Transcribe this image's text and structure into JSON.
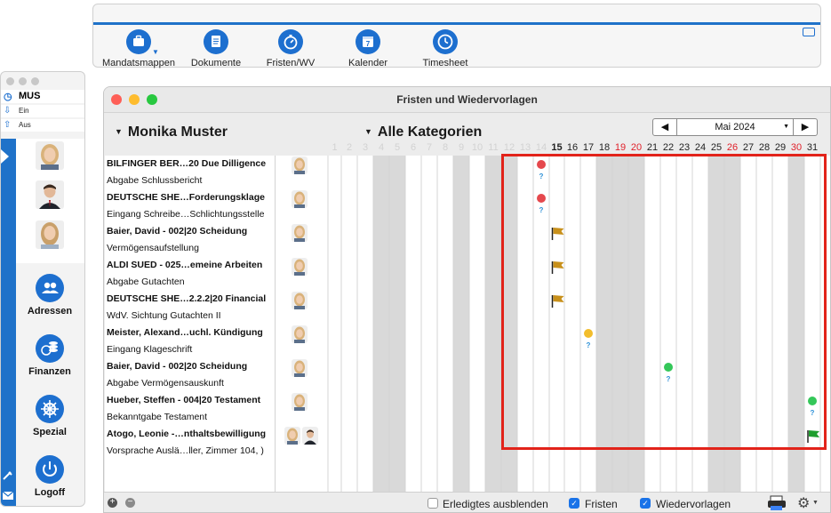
{
  "toolbar": {
    "items": [
      {
        "label": "Mandatsmappen",
        "icon": "briefcase-icon"
      },
      {
        "label": "Dokumente",
        "icon": "document-icon"
      },
      {
        "label": "Fristen/WV",
        "icon": "stopwatch-icon"
      },
      {
        "label": "Kalender",
        "icon": "calendar-icon"
      },
      {
        "label": "Timesheet",
        "icon": "clock-icon"
      }
    ],
    "calendar_day": "7"
  },
  "sidebar": {
    "user": "MUS",
    "in_label": "Ein",
    "out_label": "Aus",
    "buttons": [
      {
        "label": "Adressen",
        "icon": "contacts-icon"
      },
      {
        "label": "Finanzen",
        "icon": "coins-icon"
      },
      {
        "label": "Spezial",
        "icon": "helm-icon"
      },
      {
        "label": "Logoff",
        "icon": "power-icon"
      }
    ]
  },
  "window": {
    "title": "Fristen und Wiedervorlagen",
    "person": "Monika Muster",
    "category": "Alle Kategorien",
    "month": "Mai 2024"
  },
  "days": [
    "1",
    "2",
    "3",
    "4",
    "5",
    "6",
    "7",
    "8",
    "9",
    "10",
    "11",
    "12",
    "13",
    "14",
    "15",
    "16",
    "17",
    "18",
    "19",
    "20",
    "21",
    "22",
    "23",
    "24",
    "25",
    "26",
    "27",
    "28",
    "29",
    "30",
    "31"
  ],
  "day_styles": {
    "faded": [
      "1",
      "2",
      "3",
      "4",
      "5",
      "6",
      "7",
      "8",
      "9",
      "10",
      "11",
      "12",
      "13",
      "14"
    ],
    "today": "15",
    "red": [
      "19",
      "20",
      "26",
      "30"
    ]
  },
  "weekend_days": [
    "4",
    "5",
    "9",
    "11",
    "12",
    "18",
    "19",
    "20",
    "25",
    "26",
    "30"
  ],
  "rows": [
    {
      "title": "BILFINGER BER…20 Due Dilligence",
      "subtitle": "Abgabe Schlussbericht",
      "avatars": [
        "woman"
      ],
      "marker": {
        "type": "dot",
        "color": "#e5484d",
        "day": "14",
        "question": "?"
      }
    },
    {
      "title": "DEUTSCHE SHE…Forderungsklage",
      "subtitle": "Eingang Schreibe…Schlichtungsstelle",
      "avatars": [
        "woman"
      ],
      "marker": {
        "type": "dot",
        "color": "#e5484d",
        "day": "14",
        "question": "?"
      }
    },
    {
      "title": "Baier, David - 002|20 Scheidung",
      "subtitle": "Vermögensaufstellung",
      "avatars": [
        "woman"
      ],
      "marker": {
        "type": "flag",
        "color": "#c8901a",
        "day": "15"
      }
    },
    {
      "title": "ALDI SUED - 025…emeine Arbeiten",
      "subtitle": "Abgabe Gutachten",
      "avatars": [
        "woman"
      ],
      "marker": {
        "type": "flag",
        "color": "#c8901a",
        "day": "15"
      }
    },
    {
      "title": "DEUTSCHE SHE…2.2.2|20 Financial",
      "subtitle": "WdV. Sichtung Gutachten II",
      "avatars": [
        "woman"
      ],
      "marker": {
        "type": "flag",
        "color": "#c8901a",
        "day": "15"
      }
    },
    {
      "title": "Meister, Alexand…uchl. Kündigung",
      "subtitle": "Eingang Klageschrift",
      "avatars": [
        "woman"
      ],
      "marker": {
        "type": "dot",
        "color": "#f2bd2c",
        "day": "17",
        "question": "?"
      }
    },
    {
      "title": "Baier, David - 002|20 Scheidung",
      "subtitle": "Abgabe Vermögensauskunft",
      "avatars": [
        "woman"
      ],
      "marker": {
        "type": "dot",
        "color": "#34c759",
        "day": "22",
        "question": "?"
      }
    },
    {
      "title": "Hueber, Steffen - 004|20 Testament",
      "subtitle": "Bekanntgabe Testament",
      "avatars": [
        "woman"
      ],
      "marker": {
        "type": "dot",
        "color": "#34c759",
        "day": "31",
        "question": "?"
      }
    },
    {
      "title": "Atogo, Leonie -…nthaltsbewilligung",
      "subtitle": "Vorsprache Auslä…ller, Zimmer 104, )",
      "avatars": [
        "woman",
        "man"
      ],
      "marker": {
        "type": "flag",
        "color": "#1e9e2e",
        "day": "31"
      }
    }
  ],
  "bottom": {
    "hide_done": {
      "label": "Erledigtes ausblenden",
      "checked": false
    },
    "fristen": {
      "label": "Fristen",
      "checked": true
    },
    "wiedervorlagen": {
      "label": "Wiedervorlagen",
      "checked": true
    }
  },
  "colors": {
    "accent": "#1d6fcf",
    "weekend": "#d9d9d9",
    "highlight": "#e2231a"
  }
}
